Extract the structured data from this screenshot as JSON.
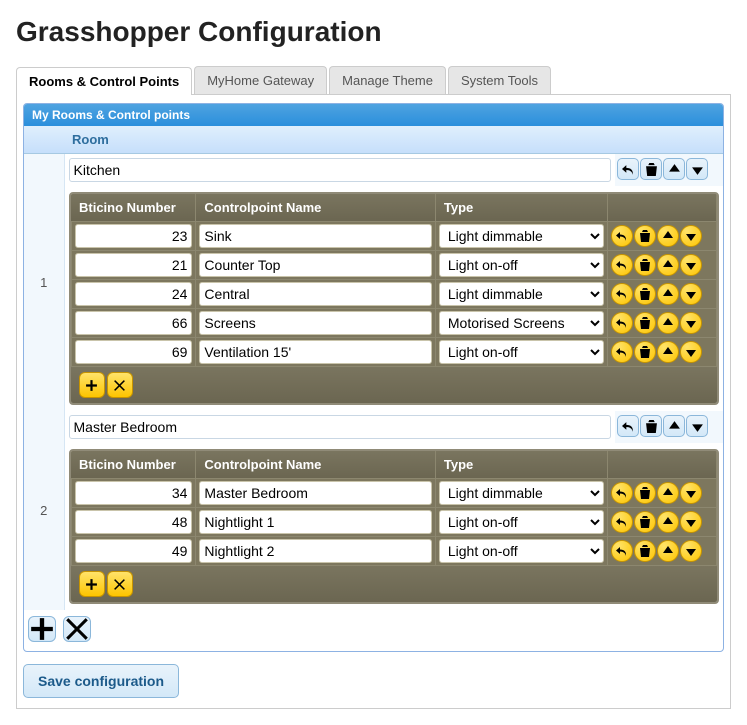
{
  "page_title": "Grasshopper Configuration",
  "tabs": [
    {
      "label": "Rooms & Control Points",
      "active": true
    },
    {
      "label": "MyHome Gateway"
    },
    {
      "label": "Manage Theme"
    },
    {
      "label": "System Tools"
    }
  ],
  "panel_title": "My Rooms & Control points",
  "outer_headers": {
    "idx": "",
    "room": "Room",
    "actions": ""
  },
  "inner_headers": {
    "num": "Bticino Number",
    "name": "Controlpoint Name",
    "type": "Type",
    "actions": ""
  },
  "type_options": [
    "Light dimmable",
    "Light on-off",
    "Motorised Screens"
  ],
  "rooms": [
    {
      "idx": "1",
      "name": "Kitchen",
      "points": [
        {
          "num": "23",
          "name": "Sink",
          "type": "Light dimmable"
        },
        {
          "num": "21",
          "name": "Counter Top",
          "type": "Light on-off"
        },
        {
          "num": "24",
          "name": "Central",
          "type": "Light dimmable"
        },
        {
          "num": "66",
          "name": "Screens",
          "type": "Motorised Screens"
        },
        {
          "num": "69",
          "name": "Ventilation 15'",
          "type": "Light on-off"
        }
      ]
    },
    {
      "idx": "2",
      "name": "Master Bedroom",
      "points": [
        {
          "num": "34",
          "name": "Master Bedroom",
          "type": "Light dimmable"
        },
        {
          "num": "48",
          "name": "Nightlight 1",
          "type": "Light on-off"
        },
        {
          "num": "49",
          "name": "Nightlight 2",
          "type": "Light on-off"
        }
      ]
    }
  ],
  "save_label": "Save configuration"
}
